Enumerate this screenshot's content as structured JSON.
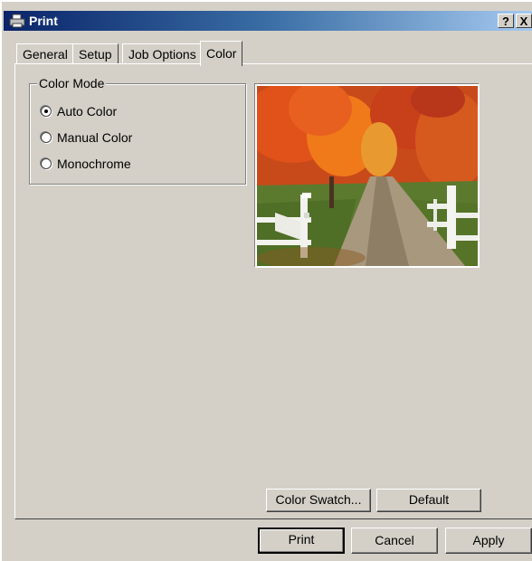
{
  "window": {
    "title": "Print",
    "help_icon": "?",
    "close_icon": "X"
  },
  "tabs": [
    {
      "label": "General"
    },
    {
      "label": "Setup"
    },
    {
      "label": "Job Options"
    },
    {
      "label": "Color"
    }
  ],
  "active_tab": "Color",
  "color_mode": {
    "legend": "Color Mode",
    "options": [
      {
        "label": "Auto Color",
        "selected": true
      },
      {
        "label": "Manual Color",
        "selected": false
      },
      {
        "label": "Monochrome",
        "selected": false
      }
    ]
  },
  "panel_buttons": {
    "color_swatch": "Color Swatch...",
    "default": "Default"
  },
  "dialog_buttons": {
    "print": "Print",
    "cancel": "Cancel",
    "apply": "Apply"
  },
  "colors": {
    "title_start": "#0a246a",
    "title_end": "#a6caf0",
    "face": "#d4d0c8"
  }
}
